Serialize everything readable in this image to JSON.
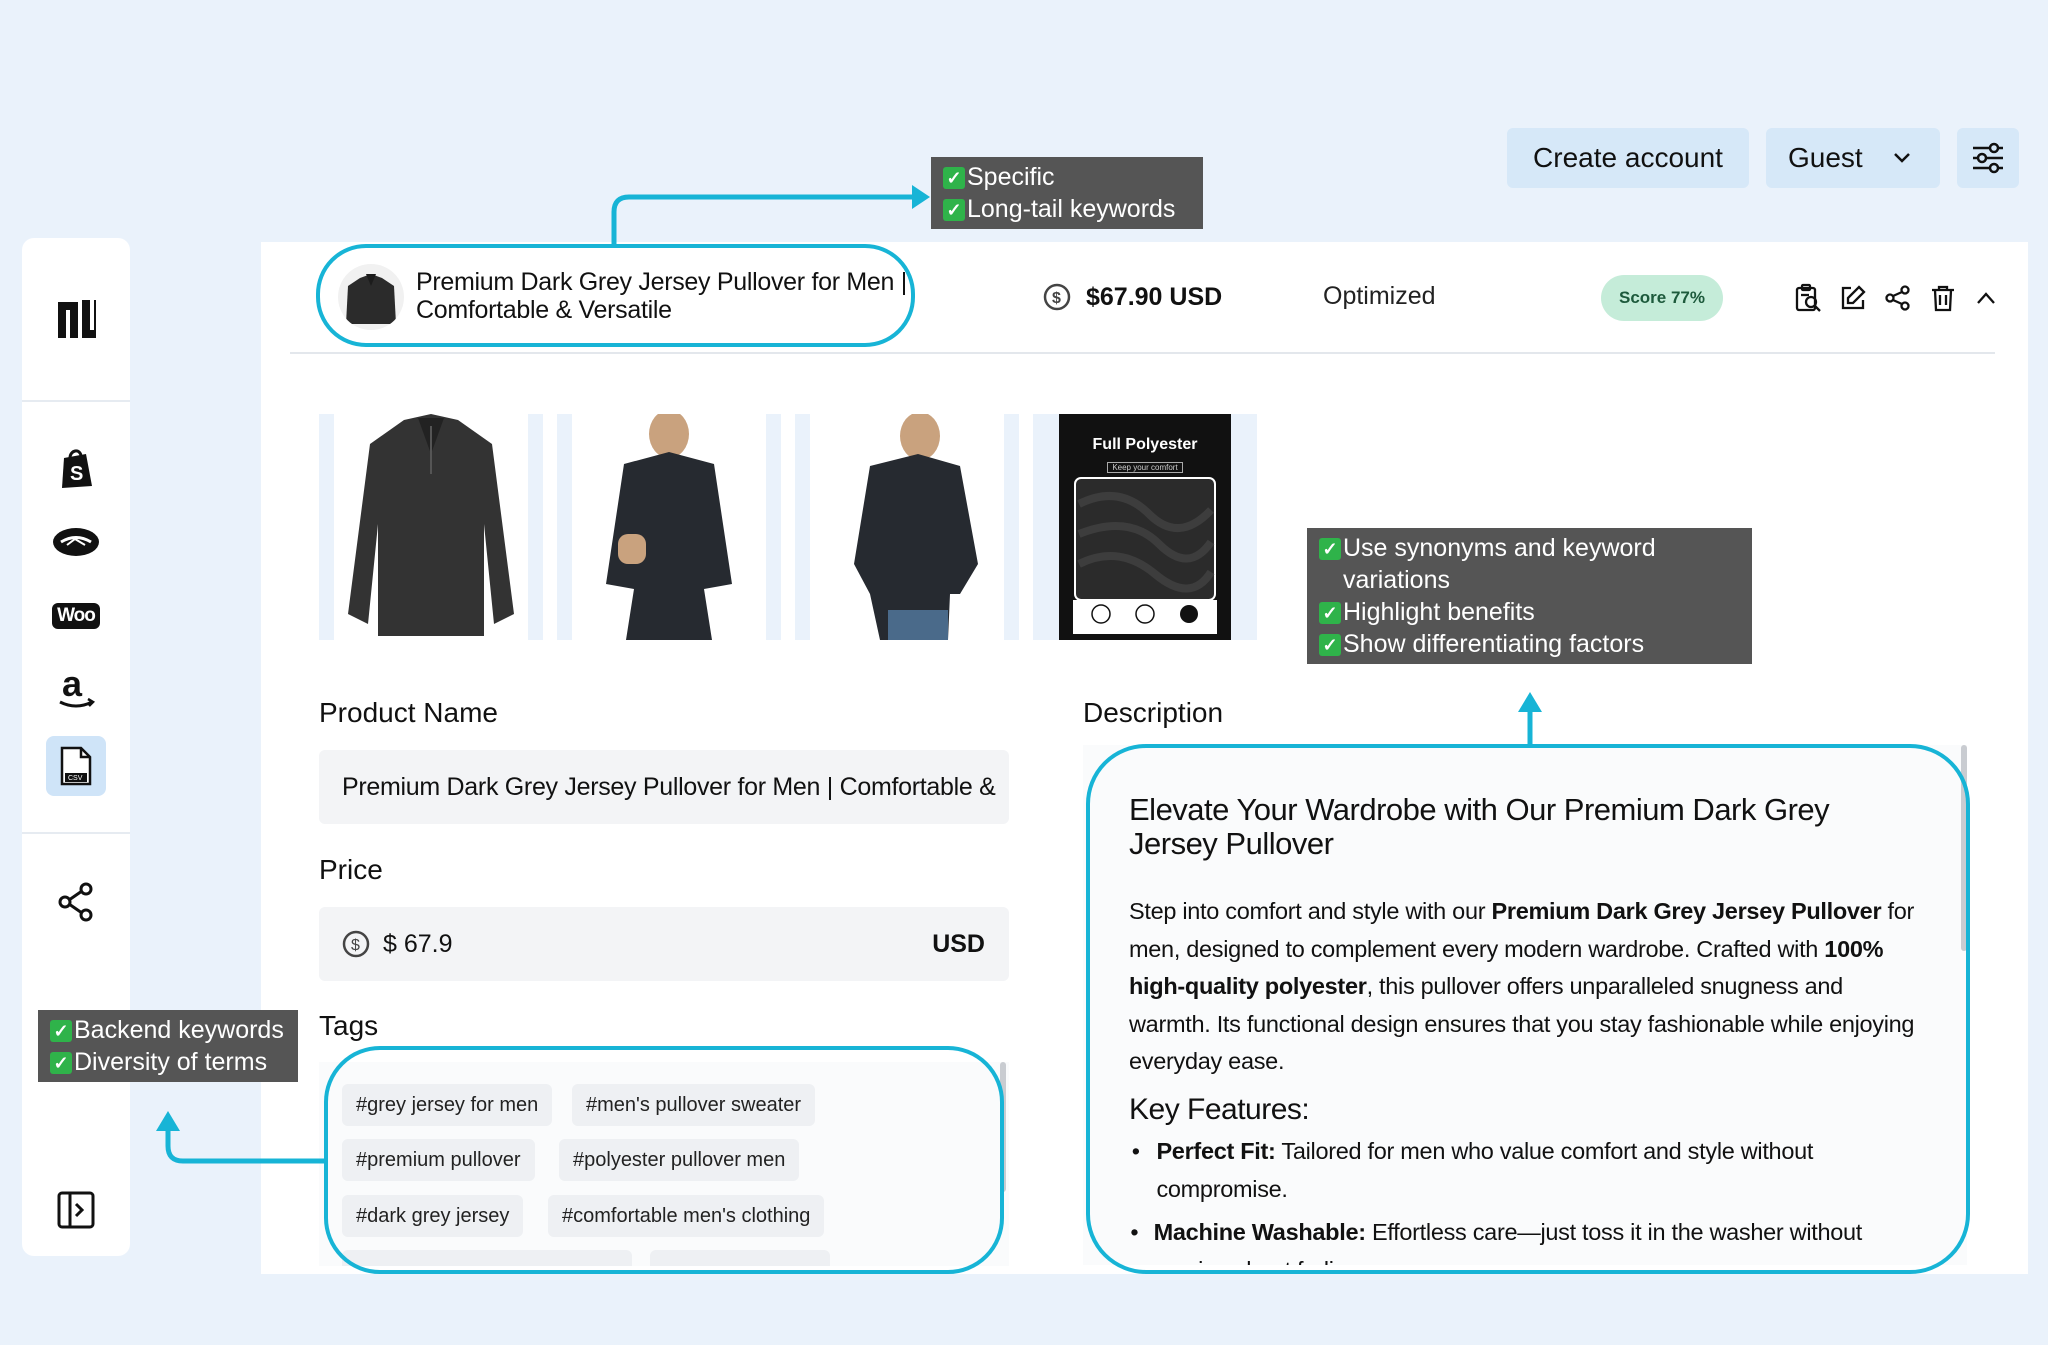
{
  "topbar": {
    "create_account": "Create account",
    "guest": "Guest"
  },
  "sidebar": {
    "items": [
      "logo-icon",
      "shopify-icon",
      "handshake-icon",
      "woo-icon",
      "amazon-icon",
      "csv-file-icon",
      "share-icon",
      "sidebar-toggle-icon"
    ],
    "woo_label": "Woo",
    "csv_label": "CSV"
  },
  "product": {
    "title_line1": "Premium Dark Grey Jersey Pullover for Men |",
    "title_line2": "Comfortable & Versatile",
    "price_display": "$67.90 USD",
    "status": "Optimized",
    "score": "Score 77%"
  },
  "gallery": {
    "image4_title": "Full Polyester",
    "image4_subtitle": "Keep your comfort"
  },
  "form": {
    "name_label": "Product Name",
    "name_value": "Premium Dark Grey Jersey Pullover for Men | Comfortable &",
    "price_label": "Price",
    "price_value": "$ 67.9",
    "currency": "USD",
    "tags_label": "Tags",
    "tags": [
      "#grey jersey for men",
      "#men's pullover sweater",
      "#premium pullover",
      "#polyester pullover men",
      "#dark grey jersey",
      "#comfortable men's clothing"
    ]
  },
  "description": {
    "label": "Description",
    "heading": "Elevate Your Wardrobe with Our Premium Dark Grey Jersey Pullover",
    "p_1": "Step into comfort and style with our ",
    "p_bold_1": "Premium Dark Grey Jersey Pullover",
    "p_2": " for men, designed to complement every modern wardrobe. Crafted with ",
    "p_bold_2": "100% high-quality polyester",
    "p_3": ", this pullover offers unparalleled snugness and warmth. Its functional design ensures that you stay fashionable while enjoying everyday ease.",
    "features_heading": "Key Features:",
    "f1_bold": "Perfect Fit:",
    "f1_text": " Tailored for men who value comfort and style without compromise.",
    "f2_bold": "Machine Washable:",
    "f2_text": " Effortless care—just toss it in the washer without worries about fading or wear."
  },
  "annotations": {
    "title_box": [
      "Specific",
      "Long-tail keywords"
    ],
    "desc_box": [
      "Use synonyms and keyword variations",
      "Highlight benefits",
      "Show differentiating factors"
    ],
    "tags_box": [
      "Backend keywords",
      "Diversity of terms"
    ]
  },
  "colors": {
    "accent_outline": "#17b4d6",
    "score_bg": "#c5ecd9",
    "page_bg": "#eaf2fb"
  }
}
